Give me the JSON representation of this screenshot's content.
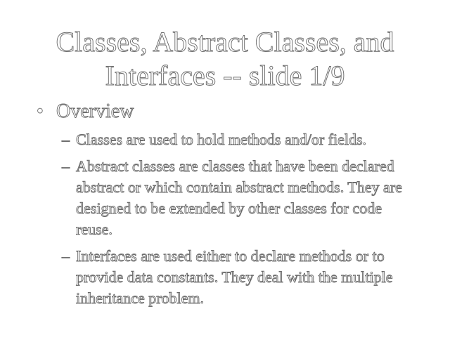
{
  "slide": {
    "title_line1": "Classes, Abstract Classes, and",
    "title_line2": "Interfaces -- slide 1/9",
    "bullet": {
      "marker": "•",
      "text": "Overview"
    },
    "sub_marker": "–",
    "sub_bullets": [
      "Classes are used to hold methods and/or fields.",
      "Abstract classes are classes that have been declared abstract or which contain abstract methods.  They are designed to be extended by other classes for code reuse.",
      "Interfaces are used either to declare methods or to provide data constants.  They deal with the multiple inheritance problem."
    ]
  }
}
